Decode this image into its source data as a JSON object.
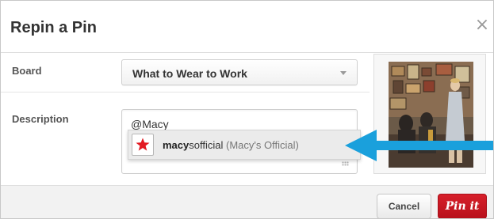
{
  "dialog": {
    "title": "Repin a Pin",
    "close_glyph": "×",
    "close_icon": "close-icon"
  },
  "board": {
    "label": "Board",
    "selected": "What to Wear to Work",
    "arrow_icon": "chevron-down-icon"
  },
  "description": {
    "label": "Description",
    "value": "@Macy"
  },
  "mention_suggestion": {
    "handle_match": "macy",
    "handle_rest": "sofficial",
    "full_name": "(Macy's Official)",
    "avatar_icon": "macys-star-logo-icon"
  },
  "annotation": {
    "arrow_icon": "left-arrow-icon",
    "color": "#1aa0dc"
  },
  "footer": {
    "cancel_label": "Cancel",
    "pin_label": "Pin it"
  },
  "colors": {
    "pin_red": "#c8171f",
    "macys_red": "#e21a22"
  }
}
